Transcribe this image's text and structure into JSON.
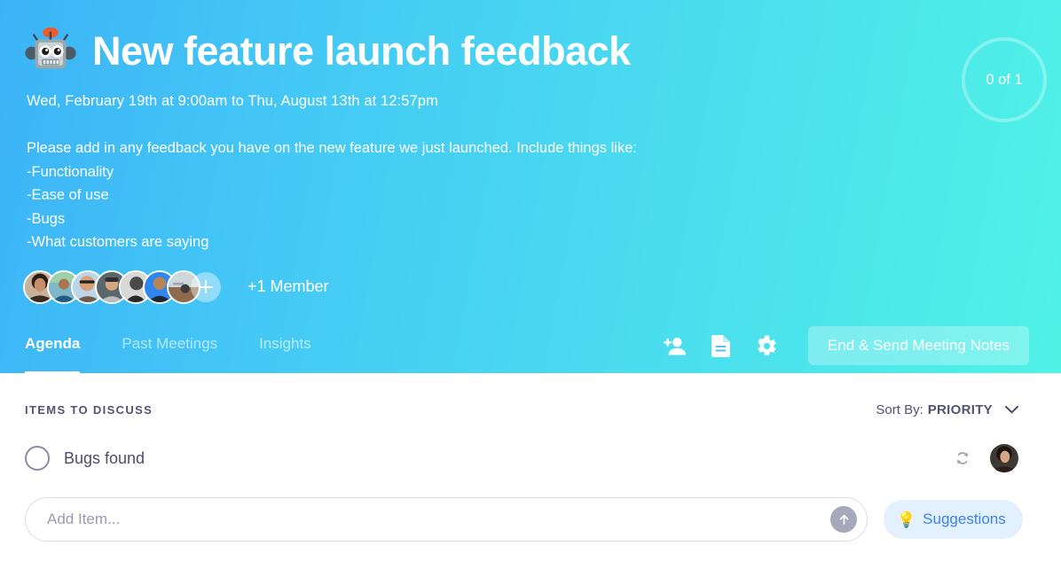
{
  "header": {
    "emoji": "robot-face",
    "title": "New feature launch feedback",
    "time_range": "Wed, February 19th at 9:00am to Thu, August 13th at 12:57pm",
    "description_lines": [
      "Please add in any feedback you have on the new feature we just launched. Include things like:",
      "-Functionality",
      "-Ease of use",
      "-Bugs",
      "-What customers are saying"
    ],
    "progress": "0 of 1",
    "members": {
      "avatar_count": 7,
      "add_label": "add-member",
      "overflow_label": "+1 Member"
    },
    "accent_left": "#3cb3f7",
    "accent_right": "#50f2e6"
  },
  "tabs": [
    {
      "label": "Agenda",
      "active": true
    },
    {
      "label": "Past Meetings",
      "active": false
    },
    {
      "label": "Insights",
      "active": false
    }
  ],
  "actions": {
    "add_person_icon": "add-person-icon",
    "document_icon": "document-icon",
    "settings_icon": "gear-icon",
    "end_button_label": "End & Send Meeting Notes"
  },
  "agenda": {
    "section_label": "ITEMS TO DISCUSS",
    "sort_prefix": "Sort By:",
    "sort_value": "PRIORITY",
    "items": [
      {
        "text": "Bugs found",
        "checked": false,
        "recurring": true
      }
    ]
  },
  "add_item": {
    "placeholder": "Add Item...",
    "value": "",
    "submit_icon": "arrow-up-icon"
  },
  "suggestions": {
    "emoji": "light-bulb",
    "label": "Suggestions",
    "color": "#3b82f6"
  }
}
